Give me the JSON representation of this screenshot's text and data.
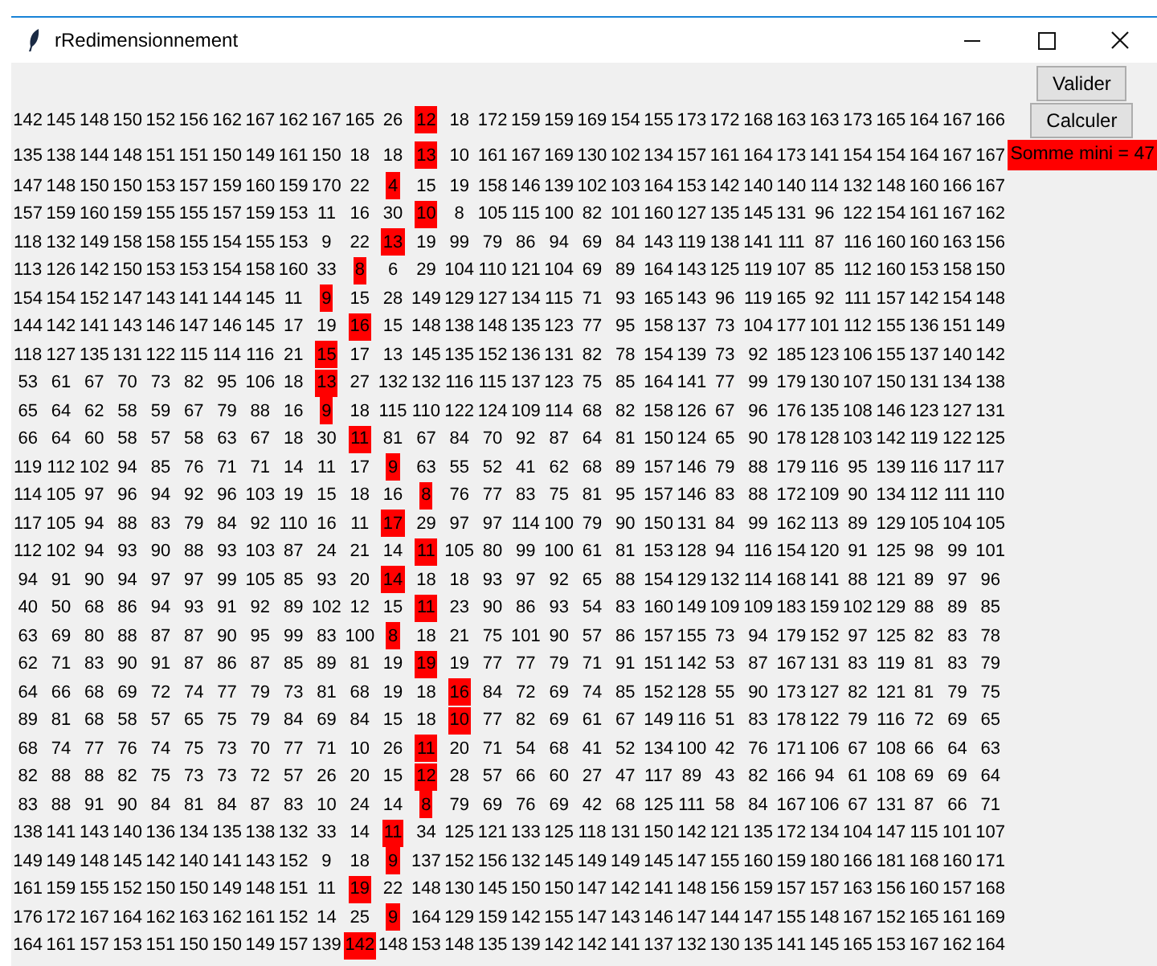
{
  "window": {
    "title": "rRedimensionnement"
  },
  "buttons": [
    {
      "label": "Valider"
    },
    {
      "label": "Calculer"
    }
  ],
  "result": {
    "text": "Somme mini = 47"
  },
  "rows": [
    {
      "values": [
        "142",
        "145",
        "148",
        "150",
        "152",
        "156",
        "162",
        "167",
        "162",
        "167",
        "165",
        "26",
        "12",
        "18",
        "172",
        "159",
        "159",
        "169",
        "154",
        "155",
        "173",
        "172",
        "168",
        "163",
        "163",
        "173",
        "165",
        "164",
        "167",
        "166"
      ],
      "highlighted": [
        false,
        false,
        false,
        false,
        false,
        false,
        false,
        false,
        false,
        false,
        false,
        false,
        true,
        false,
        false,
        false,
        false,
        false,
        false,
        false,
        false,
        false,
        false,
        false,
        false,
        false,
        false,
        false,
        false,
        false
      ]
    },
    {
      "values": [
        "135",
        "138",
        "144",
        "148",
        "151",
        "151",
        "150",
        "149",
        "161",
        "150",
        "18",
        "18",
        "13",
        "10",
        "161",
        "167",
        "169",
        "130",
        "102",
        "134",
        "157",
        "161",
        "164",
        "173",
        "141",
        "154",
        "154",
        "164",
        "167",
        "167"
      ],
      "highlighted": [
        false,
        false,
        false,
        false,
        false,
        false,
        false,
        false,
        false,
        false,
        false,
        false,
        true,
        false,
        false,
        false,
        false,
        false,
        false,
        false,
        false,
        false,
        false,
        false,
        false,
        false,
        false,
        false,
        false,
        false
      ]
    },
    {
      "values": [
        "147",
        "148",
        "150",
        "150",
        "153",
        "157",
        "159",
        "160",
        "159",
        "170",
        "22",
        "4",
        "15",
        "19",
        "158",
        "146",
        "139",
        "102",
        "103",
        "164",
        "153",
        "142",
        "140",
        "140",
        "114",
        "132",
        "148",
        "160",
        "166",
        "167"
      ],
      "highlighted": [
        false,
        false,
        false,
        false,
        false,
        false,
        false,
        false,
        false,
        false,
        false,
        true,
        false,
        false,
        false,
        false,
        false,
        false,
        false,
        false,
        false,
        false,
        false,
        false,
        false,
        false,
        false,
        false,
        false,
        false
      ]
    },
    {
      "values": [
        "157",
        "159",
        "160",
        "159",
        "155",
        "155",
        "157",
        "159",
        "153",
        "11",
        "16",
        "30",
        "10",
        "8",
        "105",
        "115",
        "100",
        "82",
        "101",
        "160",
        "127",
        "135",
        "145",
        "131",
        "96",
        "122",
        "154",
        "161",
        "167",
        "162"
      ],
      "highlighted": [
        false,
        false,
        false,
        false,
        false,
        false,
        false,
        false,
        false,
        false,
        false,
        false,
        true,
        false,
        false,
        false,
        false,
        false,
        false,
        false,
        false,
        false,
        false,
        false,
        false,
        false,
        false,
        false,
        false,
        false
      ]
    },
    {
      "values": [
        "118",
        "132",
        "149",
        "158",
        "158",
        "155",
        "154",
        "155",
        "153",
        "9",
        "22",
        "13",
        "19",
        "99",
        "79",
        "86",
        "94",
        "69",
        "84",
        "143",
        "119",
        "138",
        "141",
        "111",
        "87",
        "116",
        "160",
        "160",
        "163",
        "156"
      ],
      "highlighted": [
        false,
        false,
        false,
        false,
        false,
        false,
        false,
        false,
        false,
        false,
        false,
        true,
        false,
        false,
        false,
        false,
        false,
        false,
        false,
        false,
        false,
        false,
        false,
        false,
        false,
        false,
        false,
        false,
        false,
        false
      ]
    },
    {
      "values": [
        "113",
        "126",
        "142",
        "150",
        "153",
        "153",
        "154",
        "158",
        "160",
        "33",
        "8",
        "6",
        "29",
        "104",
        "110",
        "121",
        "104",
        "69",
        "89",
        "164",
        "143",
        "125",
        "119",
        "107",
        "85",
        "112",
        "160",
        "153",
        "158",
        "150"
      ],
      "highlighted": [
        false,
        false,
        false,
        false,
        false,
        false,
        false,
        false,
        false,
        false,
        true,
        false,
        false,
        false,
        false,
        false,
        false,
        false,
        false,
        false,
        false,
        false,
        false,
        false,
        false,
        false,
        false,
        false,
        false,
        false
      ]
    },
    {
      "values": [
        "154",
        "154",
        "152",
        "147",
        "143",
        "141",
        "144",
        "145",
        "11",
        "9",
        "15",
        "28",
        "149",
        "129",
        "127",
        "134",
        "115",
        "71",
        "93",
        "165",
        "143",
        "96",
        "119",
        "165",
        "92",
        "111",
        "157",
        "142",
        "154",
        "148"
      ],
      "highlighted": [
        false,
        false,
        false,
        false,
        false,
        false,
        false,
        false,
        false,
        true,
        false,
        false,
        false,
        false,
        false,
        false,
        false,
        false,
        false,
        false,
        false,
        false,
        false,
        false,
        false,
        false,
        false,
        false,
        false,
        false
      ]
    },
    {
      "values": [
        "144",
        "142",
        "141",
        "143",
        "146",
        "147",
        "146",
        "145",
        "17",
        "19",
        "16",
        "15",
        "148",
        "138",
        "148",
        "135",
        "123",
        "77",
        "95",
        "158",
        "137",
        "73",
        "104",
        "177",
        "101",
        "112",
        "155",
        "136",
        "151",
        "149"
      ],
      "highlighted": [
        false,
        false,
        false,
        false,
        false,
        false,
        false,
        false,
        false,
        false,
        true,
        false,
        false,
        false,
        false,
        false,
        false,
        false,
        false,
        false,
        false,
        false,
        false,
        false,
        false,
        false,
        false,
        false,
        false,
        false
      ]
    },
    {
      "values": [
        "118",
        "127",
        "135",
        "131",
        "122",
        "115",
        "114",
        "116",
        "21",
        "15",
        "17",
        "13",
        "145",
        "135",
        "152",
        "136",
        "131",
        "82",
        "78",
        "154",
        "139",
        "73",
        "92",
        "185",
        "123",
        "106",
        "155",
        "137",
        "140",
        "142"
      ],
      "highlighted": [
        false,
        false,
        false,
        false,
        false,
        false,
        false,
        false,
        false,
        true,
        false,
        false,
        false,
        false,
        false,
        false,
        false,
        false,
        false,
        false,
        false,
        false,
        false,
        false,
        false,
        false,
        false,
        false,
        false,
        false
      ]
    },
    {
      "values": [
        "53",
        "61",
        "67",
        "70",
        "73",
        "82",
        "95",
        "106",
        "18",
        "13",
        "27",
        "132",
        "132",
        "116",
        "115",
        "137",
        "123",
        "75",
        "85",
        "164",
        "141",
        "77",
        "99",
        "179",
        "130",
        "107",
        "150",
        "131",
        "134",
        "138"
      ],
      "highlighted": [
        false,
        false,
        false,
        false,
        false,
        false,
        false,
        false,
        false,
        true,
        false,
        false,
        false,
        false,
        false,
        false,
        false,
        false,
        false,
        false,
        false,
        false,
        false,
        false,
        false,
        false,
        false,
        false,
        false,
        false
      ]
    },
    {
      "values": [
        "65",
        "64",
        "62",
        "58",
        "59",
        "67",
        "79",
        "88",
        "16",
        "9",
        "18",
        "115",
        "110",
        "122",
        "124",
        "109",
        "114",
        "68",
        "82",
        "158",
        "126",
        "67",
        "96",
        "176",
        "135",
        "108",
        "146",
        "123",
        "127",
        "131"
      ],
      "highlighted": [
        false,
        false,
        false,
        false,
        false,
        false,
        false,
        false,
        false,
        true,
        false,
        false,
        false,
        false,
        false,
        false,
        false,
        false,
        false,
        false,
        false,
        false,
        false,
        false,
        false,
        false,
        false,
        false,
        false,
        false
      ]
    },
    {
      "values": [
        "66",
        "64",
        "60",
        "58",
        "57",
        "58",
        "63",
        "67",
        "18",
        "30",
        "11",
        "81",
        "67",
        "84",
        "70",
        "92",
        "87",
        "64",
        "81",
        "150",
        "124",
        "65",
        "90",
        "178",
        "128",
        "103",
        "142",
        "119",
        "122",
        "125"
      ],
      "highlighted": [
        false,
        false,
        false,
        false,
        false,
        false,
        false,
        false,
        false,
        false,
        true,
        false,
        false,
        false,
        false,
        false,
        false,
        false,
        false,
        false,
        false,
        false,
        false,
        false,
        false,
        false,
        false,
        false,
        false,
        false
      ]
    },
    {
      "values": [
        "119",
        "112",
        "102",
        "94",
        "85",
        "76",
        "71",
        "71",
        "14",
        "11",
        "17",
        "9",
        "63",
        "55",
        "52",
        "41",
        "62",
        "68",
        "89",
        "157",
        "146",
        "79",
        "88",
        "179",
        "116",
        "95",
        "139",
        "116",
        "117",
        "117"
      ],
      "highlighted": [
        false,
        false,
        false,
        false,
        false,
        false,
        false,
        false,
        false,
        false,
        false,
        true,
        false,
        false,
        false,
        false,
        false,
        false,
        false,
        false,
        false,
        false,
        false,
        false,
        false,
        false,
        false,
        false,
        false,
        false
      ]
    },
    {
      "values": [
        "114",
        "105",
        "97",
        "96",
        "94",
        "92",
        "96",
        "103",
        "19",
        "15",
        "18",
        "16",
        "8",
        "76",
        "77",
        "83",
        "75",
        "81",
        "95",
        "157",
        "146",
        "83",
        "88",
        "172",
        "109",
        "90",
        "134",
        "112",
        "111",
        "110"
      ],
      "highlighted": [
        false,
        false,
        false,
        false,
        false,
        false,
        false,
        false,
        false,
        false,
        false,
        false,
        true,
        false,
        false,
        false,
        false,
        false,
        false,
        false,
        false,
        false,
        false,
        false,
        false,
        false,
        false,
        false,
        false,
        false
      ]
    },
    {
      "values": [
        "117",
        "105",
        "94",
        "88",
        "83",
        "79",
        "84",
        "92",
        "110",
        "16",
        "11",
        "17",
        "29",
        "97",
        "97",
        "114",
        "100",
        "79",
        "90",
        "150",
        "131",
        "84",
        "99",
        "162",
        "113",
        "89",
        "129",
        "105",
        "104",
        "105"
      ],
      "highlighted": [
        false,
        false,
        false,
        false,
        false,
        false,
        false,
        false,
        false,
        false,
        false,
        true,
        false,
        false,
        false,
        false,
        false,
        false,
        false,
        false,
        false,
        false,
        false,
        false,
        false,
        false,
        false,
        false,
        false,
        false
      ]
    },
    {
      "values": [
        "112",
        "102",
        "94",
        "93",
        "90",
        "88",
        "93",
        "103",
        "87",
        "24",
        "21",
        "14",
        "11",
        "105",
        "80",
        "99",
        "100",
        "61",
        "81",
        "153",
        "128",
        "94",
        "116",
        "154",
        "120",
        "91",
        "125",
        "98",
        "99",
        "101"
      ],
      "highlighted": [
        false,
        false,
        false,
        false,
        false,
        false,
        false,
        false,
        false,
        false,
        false,
        false,
        true,
        false,
        false,
        false,
        false,
        false,
        false,
        false,
        false,
        false,
        false,
        false,
        false,
        false,
        false,
        false,
        false,
        false
      ]
    },
    {
      "values": [
        "94",
        "91",
        "90",
        "94",
        "97",
        "97",
        "99",
        "105",
        "85",
        "93",
        "20",
        "14",
        "18",
        "18",
        "93",
        "97",
        "92",
        "65",
        "88",
        "154",
        "129",
        "132",
        "114",
        "168",
        "141",
        "88",
        "121",
        "89",
        "97",
        "96"
      ],
      "highlighted": [
        false,
        false,
        false,
        false,
        false,
        false,
        false,
        false,
        false,
        false,
        false,
        true,
        false,
        false,
        false,
        false,
        false,
        false,
        false,
        false,
        false,
        false,
        false,
        false,
        false,
        false,
        false,
        false,
        false,
        false
      ]
    },
    {
      "values": [
        "40",
        "50",
        "68",
        "86",
        "94",
        "93",
        "91",
        "92",
        "89",
        "102",
        "12",
        "15",
        "11",
        "23",
        "90",
        "86",
        "93",
        "54",
        "83",
        "160",
        "149",
        "109",
        "109",
        "183",
        "159",
        "102",
        "129",
        "88",
        "89",
        "85"
      ],
      "highlighted": [
        false,
        false,
        false,
        false,
        false,
        false,
        false,
        false,
        false,
        false,
        false,
        false,
        true,
        false,
        false,
        false,
        false,
        false,
        false,
        false,
        false,
        false,
        false,
        false,
        false,
        false,
        false,
        false,
        false,
        false
      ]
    },
    {
      "values": [
        "63",
        "69",
        "80",
        "88",
        "87",
        "87",
        "90",
        "95",
        "99",
        "83",
        "100",
        "8",
        "18",
        "21",
        "75",
        "101",
        "90",
        "57",
        "86",
        "157",
        "155",
        "73",
        "94",
        "179",
        "152",
        "97",
        "125",
        "82",
        "83",
        "78"
      ],
      "highlighted": [
        false,
        false,
        false,
        false,
        false,
        false,
        false,
        false,
        false,
        false,
        false,
        true,
        false,
        false,
        false,
        false,
        false,
        false,
        false,
        false,
        false,
        false,
        false,
        false,
        false,
        false,
        false,
        false,
        false,
        false
      ]
    },
    {
      "values": [
        "62",
        "71",
        "83",
        "90",
        "91",
        "87",
        "86",
        "87",
        "85",
        "89",
        "81",
        "19",
        "19",
        "19",
        "77",
        "77",
        "79",
        "71",
        "91",
        "151",
        "142",
        "53",
        "87",
        "167",
        "131",
        "83",
        "119",
        "81",
        "83",
        "79"
      ],
      "highlighted": [
        false,
        false,
        false,
        false,
        false,
        false,
        false,
        false,
        false,
        false,
        false,
        false,
        true,
        false,
        false,
        false,
        false,
        false,
        false,
        false,
        false,
        false,
        false,
        false,
        false,
        false,
        false,
        false,
        false,
        false
      ]
    },
    {
      "values": [
        "64",
        "66",
        "68",
        "69",
        "72",
        "74",
        "77",
        "79",
        "73",
        "81",
        "68",
        "19",
        "18",
        "16",
        "84",
        "72",
        "69",
        "74",
        "85",
        "152",
        "128",
        "55",
        "90",
        "173",
        "127",
        "82",
        "121",
        "81",
        "79",
        "75"
      ],
      "highlighted": [
        false,
        false,
        false,
        false,
        false,
        false,
        false,
        false,
        false,
        false,
        false,
        false,
        false,
        true,
        false,
        false,
        false,
        false,
        false,
        false,
        false,
        false,
        false,
        false,
        false,
        false,
        false,
        false,
        false,
        false
      ]
    },
    {
      "values": [
        "89",
        "81",
        "68",
        "58",
        "57",
        "65",
        "75",
        "79",
        "84",
        "69",
        "84",
        "15",
        "18",
        "10",
        "77",
        "82",
        "69",
        "61",
        "67",
        "149",
        "116",
        "51",
        "83",
        "178",
        "122",
        "79",
        "116",
        "72",
        "69",
        "65"
      ],
      "highlighted": [
        false,
        false,
        false,
        false,
        false,
        false,
        false,
        false,
        false,
        false,
        false,
        false,
        false,
        true,
        false,
        false,
        false,
        false,
        false,
        false,
        false,
        false,
        false,
        false,
        false,
        false,
        false,
        false,
        false,
        false
      ]
    },
    {
      "values": [
        "68",
        "74",
        "77",
        "76",
        "74",
        "75",
        "73",
        "70",
        "77",
        "71",
        "10",
        "26",
        "11",
        "20",
        "71",
        "54",
        "68",
        "41",
        "52",
        "134",
        "100",
        "42",
        "76",
        "171",
        "106",
        "67",
        "108",
        "66",
        "64",
        "63"
      ],
      "highlighted": [
        false,
        false,
        false,
        false,
        false,
        false,
        false,
        false,
        false,
        false,
        false,
        false,
        true,
        false,
        false,
        false,
        false,
        false,
        false,
        false,
        false,
        false,
        false,
        false,
        false,
        false,
        false,
        false,
        false,
        false
      ]
    },
    {
      "values": [
        "82",
        "88",
        "88",
        "82",
        "75",
        "73",
        "73",
        "72",
        "57",
        "26",
        "20",
        "15",
        "12",
        "28",
        "57",
        "66",
        "60",
        "27",
        "47",
        "117",
        "89",
        "43",
        "82",
        "166",
        "94",
        "61",
        "108",
        "69",
        "69",
        "64"
      ],
      "highlighted": [
        false,
        false,
        false,
        false,
        false,
        false,
        false,
        false,
        false,
        false,
        false,
        false,
        true,
        false,
        false,
        false,
        false,
        false,
        false,
        false,
        false,
        false,
        false,
        false,
        false,
        false,
        false,
        false,
        false,
        false
      ]
    },
    {
      "values": [
        "83",
        "88",
        "91",
        "90",
        "84",
        "81",
        "84",
        "87",
        "83",
        "10",
        "24",
        "14",
        "8",
        "79",
        "69",
        "76",
        "69",
        "42",
        "68",
        "125",
        "111",
        "58",
        "84",
        "167",
        "106",
        "67",
        "131",
        "87",
        "66",
        "71"
      ],
      "highlighted": [
        false,
        false,
        false,
        false,
        false,
        false,
        false,
        false,
        false,
        false,
        false,
        false,
        true,
        false,
        false,
        false,
        false,
        false,
        false,
        false,
        false,
        false,
        false,
        false,
        false,
        false,
        false,
        false,
        false,
        false
      ]
    },
    {
      "values": [
        "138",
        "141",
        "143",
        "140",
        "136",
        "134",
        "135",
        "138",
        "132",
        "33",
        "14",
        "11",
        "34",
        "125",
        "121",
        "133",
        "125",
        "118",
        "131",
        "150",
        "142",
        "121",
        "135",
        "172",
        "134",
        "104",
        "147",
        "115",
        "101",
        "107"
      ],
      "highlighted": [
        false,
        false,
        false,
        false,
        false,
        false,
        false,
        false,
        false,
        false,
        false,
        true,
        false,
        false,
        false,
        false,
        false,
        false,
        false,
        false,
        false,
        false,
        false,
        false,
        false,
        false,
        false,
        false,
        false,
        false
      ]
    },
    {
      "values": [
        "149",
        "149",
        "148",
        "145",
        "142",
        "140",
        "141",
        "143",
        "152",
        "9",
        "18",
        "9",
        "137",
        "152",
        "156",
        "132",
        "145",
        "149",
        "149",
        "145",
        "147",
        "155",
        "160",
        "159",
        "180",
        "166",
        "181",
        "168",
        "160",
        "171"
      ],
      "highlighted": [
        false,
        false,
        false,
        false,
        false,
        false,
        false,
        false,
        false,
        false,
        false,
        true,
        false,
        false,
        false,
        false,
        false,
        false,
        false,
        false,
        false,
        false,
        false,
        false,
        false,
        false,
        false,
        false,
        false,
        false
      ]
    },
    {
      "values": [
        "161",
        "159",
        "155",
        "152",
        "150",
        "150",
        "149",
        "148",
        "151",
        "11",
        "19",
        "22",
        "148",
        "130",
        "145",
        "150",
        "150",
        "147",
        "142",
        "141",
        "148",
        "156",
        "159",
        "157",
        "157",
        "163",
        "156",
        "160",
        "157",
        "168"
      ],
      "highlighted": [
        false,
        false,
        false,
        false,
        false,
        false,
        false,
        false,
        false,
        false,
        true,
        false,
        false,
        false,
        false,
        false,
        false,
        false,
        false,
        false,
        false,
        false,
        false,
        false,
        false,
        false,
        false,
        false,
        false,
        false
      ]
    },
    {
      "values": [
        "176",
        "172",
        "167",
        "164",
        "162",
        "163",
        "162",
        "161",
        "152",
        "14",
        "25",
        "9",
        "164",
        "129",
        "159",
        "142",
        "155",
        "147",
        "143",
        "146",
        "147",
        "144",
        "147",
        "155",
        "148",
        "167",
        "152",
        "165",
        "161",
        "169"
      ],
      "highlighted": [
        false,
        false,
        false,
        false,
        false,
        false,
        false,
        false,
        false,
        false,
        false,
        true,
        false,
        false,
        false,
        false,
        false,
        false,
        false,
        false,
        false,
        false,
        false,
        false,
        false,
        false,
        false,
        false,
        false,
        false
      ]
    },
    {
      "values": [
        "164",
        "161",
        "157",
        "153",
        "151",
        "150",
        "150",
        "149",
        "157",
        "139",
        "142",
        "148",
        "153",
        "148",
        "135",
        "139",
        "142",
        "142",
        "141",
        "137",
        "132",
        "130",
        "135",
        "141",
        "145",
        "165",
        "153",
        "167",
        "162",
        "164"
      ],
      "highlighted": [
        false,
        false,
        false,
        false,
        false,
        false,
        false,
        false,
        false,
        false,
        true,
        false,
        false,
        false,
        false,
        false,
        false,
        false,
        false,
        false,
        false,
        false,
        false,
        false,
        false,
        false,
        false,
        false,
        false,
        false
      ]
    }
  ]
}
